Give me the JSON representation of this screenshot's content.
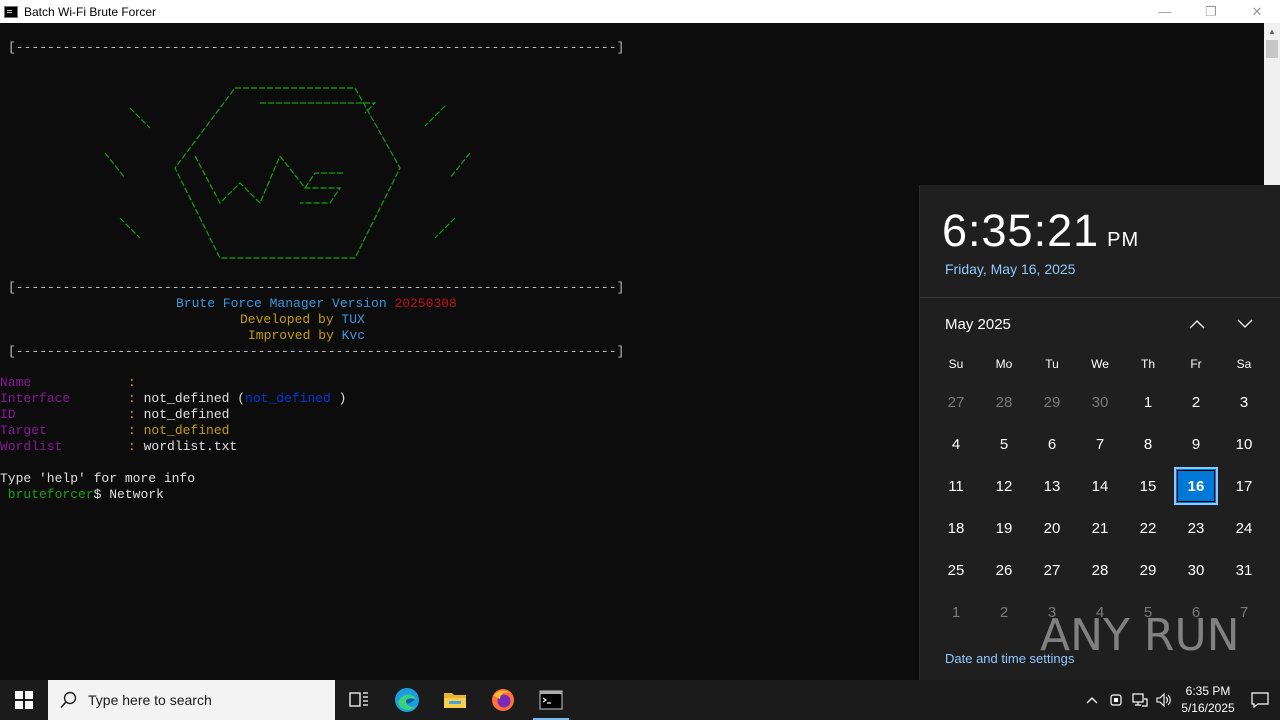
{
  "window": {
    "title": "Batch Wi-Fi Brute Forcer",
    "minimize": "—",
    "restore": "❐",
    "close": "✕"
  },
  "console": {
    "separator": "[-----------------------------------------------------------------------------]",
    "banner_line1_prefix": "Brute Force Manager Version ",
    "banner_version": "20250308",
    "banner_line2_prefix": "Developed by ",
    "banner_line2_name": "TUX",
    "banner_line3_prefix": "Improved by ",
    "banner_line3_name": "Kvc",
    "fields": {
      "name_label": "Name",
      "interface_label": "Interface",
      "interface_value": "not_defined",
      "interface_paren_value": "not_defined",
      "id_label": "ID",
      "id_value": "not_defined",
      "target_label": "Target",
      "target_value": "not_defined",
      "wordlist_label": "Wordlist",
      "wordlist_value": "wordlist.txt"
    },
    "help_text": "Type 'help' for more info",
    "prompt": " bruteforcer",
    "prompt_symbol": "$ ",
    "command": "Network"
  },
  "calendar": {
    "time": "6:35:21",
    "ampm": "PM",
    "date_long": "Friday, May 16, 2025",
    "month_label": "May 2025",
    "weekdays": [
      "Su",
      "Mo",
      "Tu",
      "We",
      "Th",
      "Fr",
      "Sa"
    ],
    "days": [
      "27",
      "28",
      "29",
      "30",
      "1",
      "2",
      "3",
      "4",
      "5",
      "6",
      "7",
      "8",
      "9",
      "10",
      "11",
      "12",
      "13",
      "14",
      "15",
      "16",
      "17",
      "18",
      "19",
      "20",
      "21",
      "22",
      "23",
      "24",
      "25",
      "26",
      "27",
      "28",
      "29",
      "30",
      "31",
      "1",
      "2",
      "3",
      "4",
      "5",
      "6",
      "7"
    ],
    "settings_link": "Date and time settings",
    "watermark": "ANY RUN"
  },
  "taskbar": {
    "search_placeholder": "Type here to search",
    "time": "6:35 PM",
    "date": "5/16/2025"
  },
  "colors": {
    "accent": "#0078d7",
    "console_green": "#13a10e",
    "console_teal": "#3a96dd",
    "console_red": "#c50f1f",
    "console_yellow": "#c19c00",
    "console_purple": "#881798"
  }
}
